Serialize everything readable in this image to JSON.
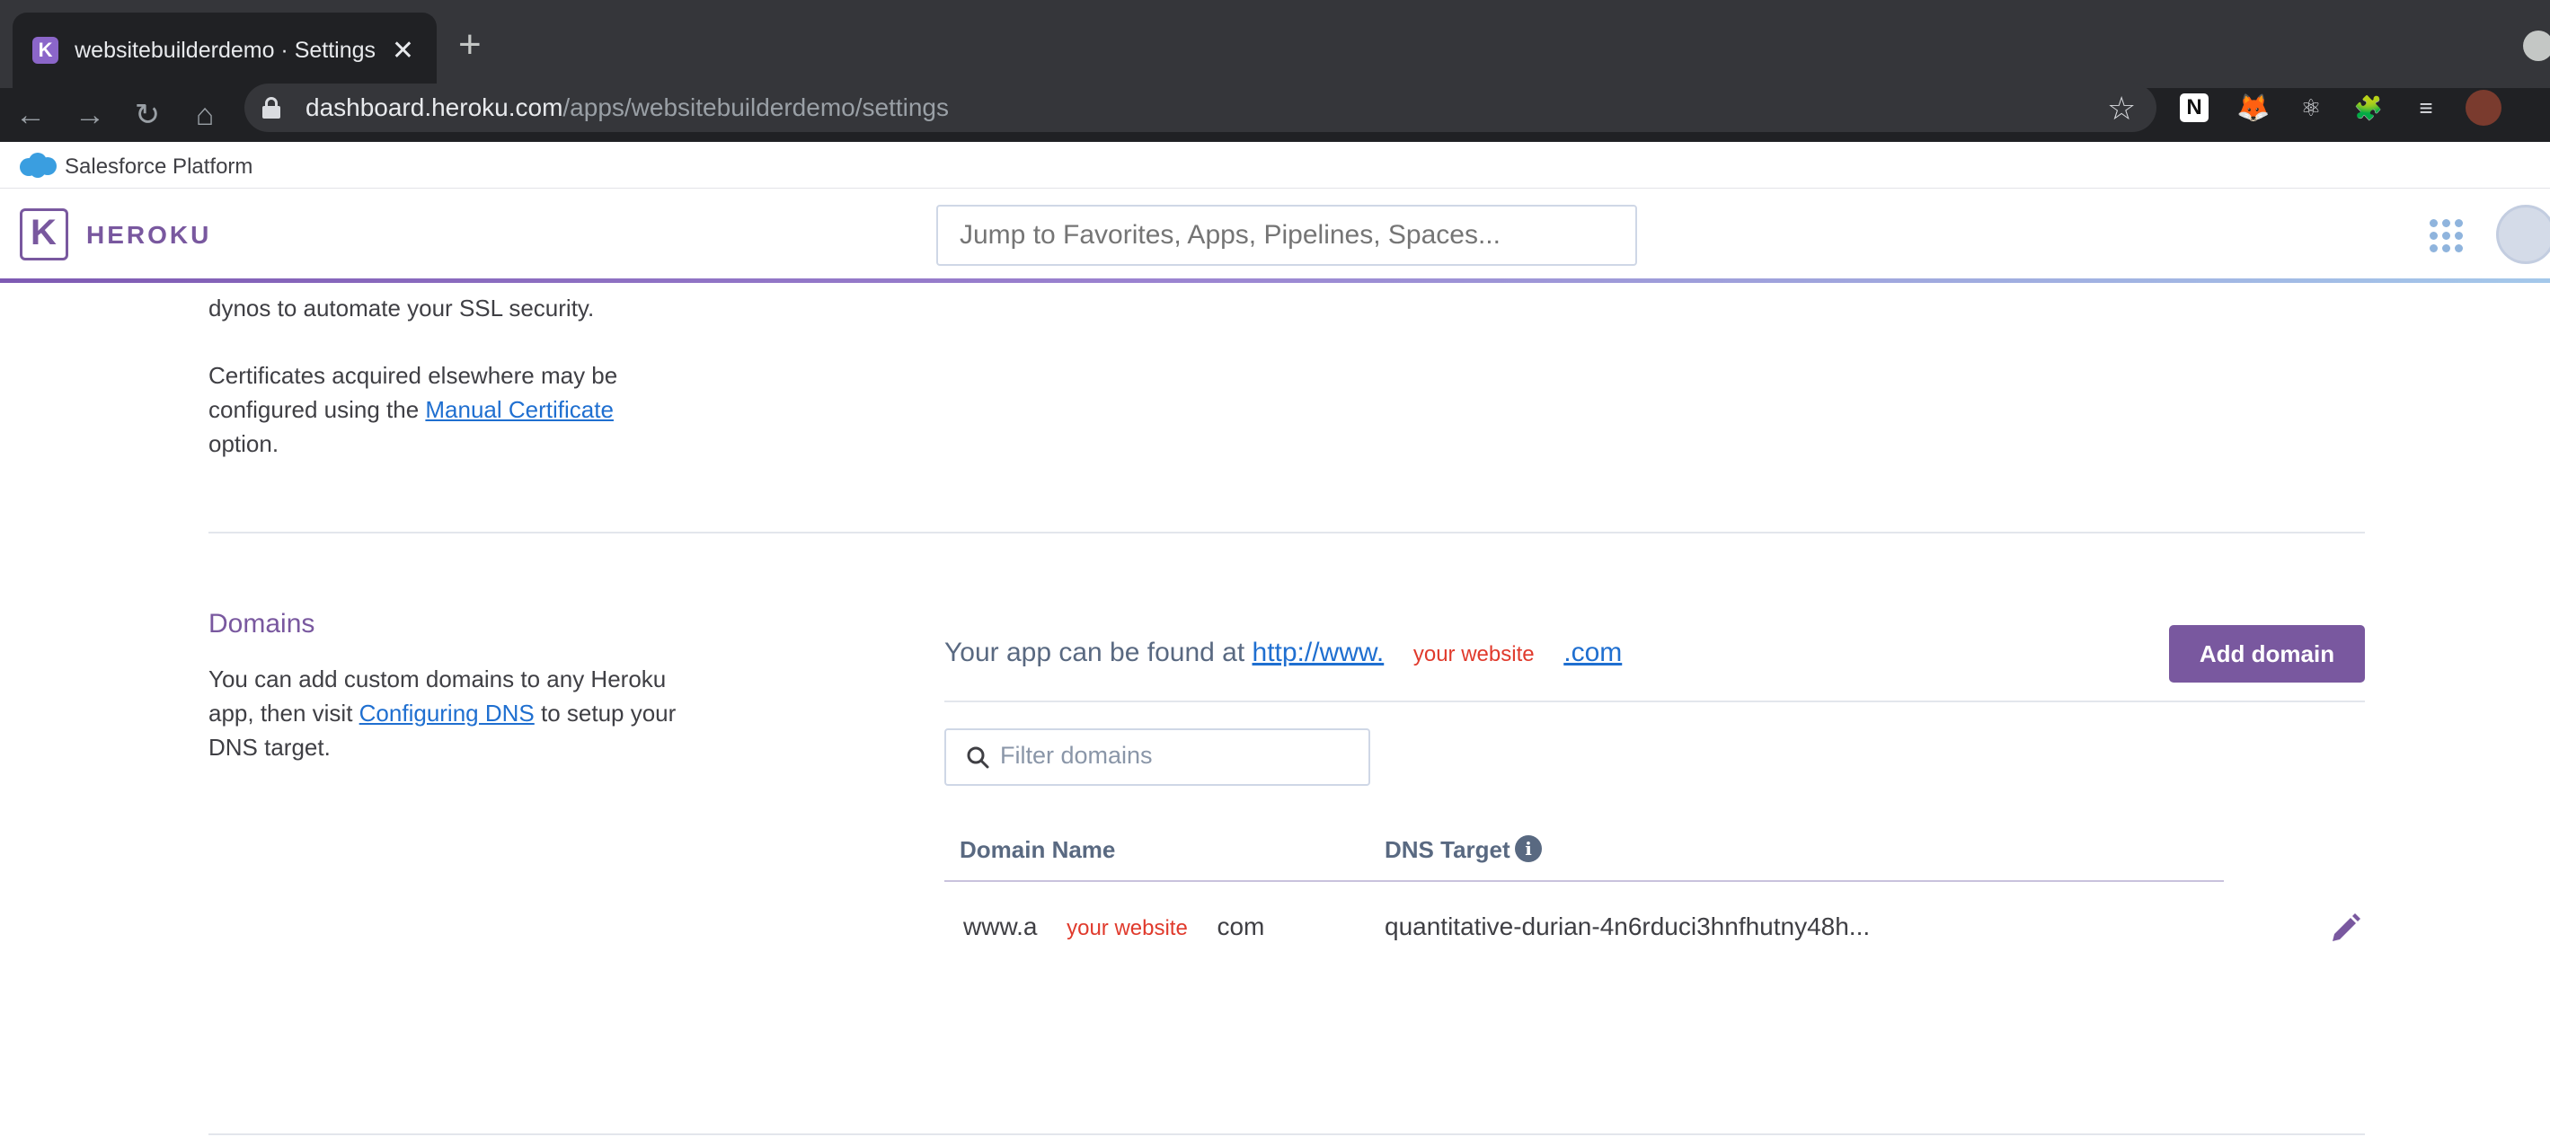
{
  "browser": {
    "tab_title": "websitebuilderdemo · Settings",
    "tab_close": "✕",
    "new_tab": "+",
    "url_host": "dashboard.heroku.com",
    "url_path": "/apps/websitebuilderdemo/settings",
    "nav": {
      "back": "←",
      "forward": "→",
      "reload": "↻",
      "home": "⌂"
    },
    "extensions": {
      "notion": "N",
      "metamask": "🦊",
      "react": "⚛",
      "puzzle": "🧩",
      "media": "≡",
      "star": "☆",
      "menu": "⋮"
    }
  },
  "salesforce": {
    "label": "Salesforce Platform",
    "color": "#3a9ee0"
  },
  "heroku": {
    "logo_letter": "K",
    "wordmark": "HEROKU",
    "search_placeholder": "Jump to Favorites, Apps, Pipelines, Spaces...",
    "brand_color": "#79589f"
  },
  "ssl_section": {
    "line_partial": "dynos to automate your SSL security.",
    "cert_line1": "Certificates acquired elsewhere may be",
    "cert_line2_prefix": "configured using the ",
    "cert_link": "Manual Certificate",
    "cert_line3": "option."
  },
  "domains": {
    "title": "Domains",
    "desc_line1": "You can add custom domains to any Heroku",
    "desc_line2_prefix": "app, then visit ",
    "desc_link": "Configuring DNS",
    "desc_line2_suffix": " to setup your",
    "desc_line3": "DNS target.",
    "found_prefix": "Your app can be found at ",
    "found_link_start": "http://www.",
    "found_redaction": "your website",
    "found_link_end": ".com",
    "add_button": "Add domain",
    "filter_placeholder": "Filter domains",
    "columns": {
      "domain": "Domain Name",
      "dns": "DNS Target"
    },
    "info_glyph": "i",
    "rows": [
      {
        "domain_start": "www.a",
        "domain_redaction": "your website",
        "domain_end": "com",
        "dns_target": "quantitative-durian-4n6rduci3hnfhutny48h..."
      }
    ]
  }
}
